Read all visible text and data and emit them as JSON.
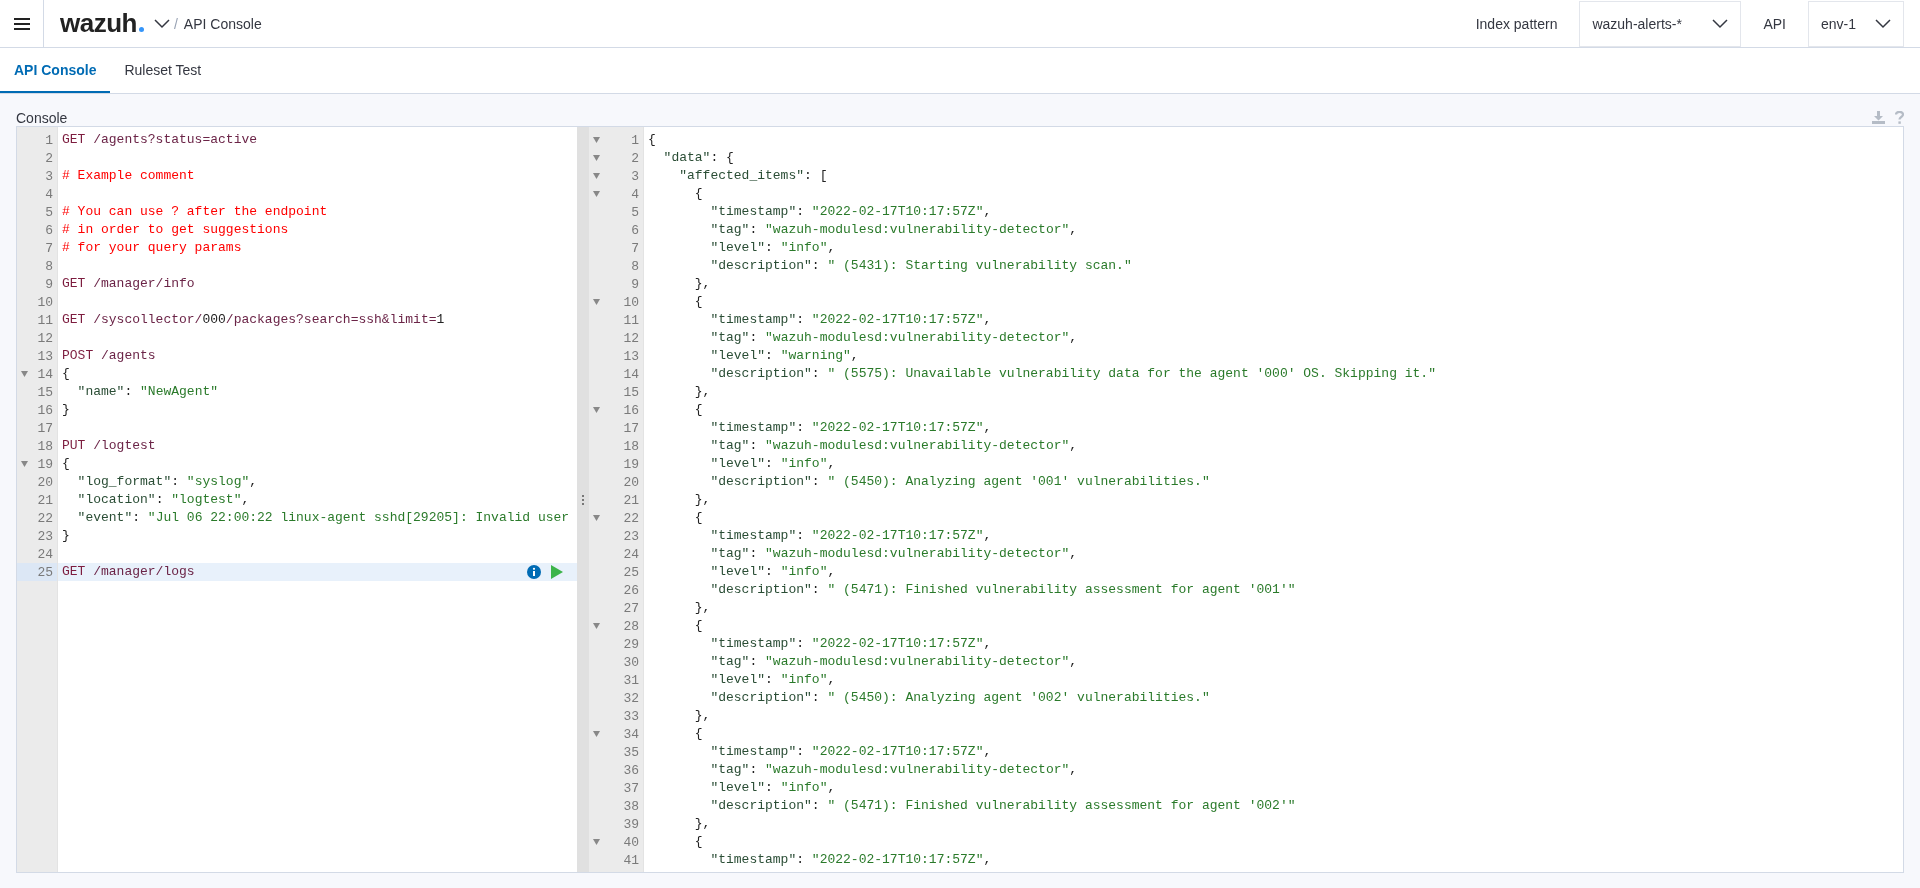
{
  "header": {
    "logo": "wazuh",
    "breadcrumb_separator": "/",
    "breadcrumb": "API Console",
    "index_pattern_label": "Index pattern",
    "index_pattern_value": "wazuh-alerts-*",
    "api_label": "API",
    "api_value": "env-1"
  },
  "tabs": [
    {
      "label": "API Console",
      "selected": true
    },
    {
      "label": "Ruleset Test",
      "selected": false
    }
  ],
  "console": {
    "title": "Console",
    "request_lines": [
      {
        "n": "1",
        "fold": false,
        "active": false,
        "tokens": [
          {
            "kind": "method",
            "text": "GET"
          },
          {
            "kind": "url",
            "text": " /agents?status=active"
          }
        ]
      },
      {
        "n": "2",
        "fold": false,
        "active": false
      },
      {
        "n": "3",
        "fold": false,
        "active": false,
        "tokens": [
          {
            "kind": "comment",
            "text": "# Example comment"
          }
        ]
      },
      {
        "n": "4",
        "fold": false,
        "active": false
      },
      {
        "n": "5",
        "fold": false,
        "active": false,
        "tokens": [
          {
            "kind": "comment",
            "text": "# You can use ? after the endpoint"
          }
        ]
      },
      {
        "n": "6",
        "fold": false,
        "active": false,
        "tokens": [
          {
            "kind": "comment",
            "text": "# in order to get suggestions"
          }
        ]
      },
      {
        "n": "7",
        "fold": false,
        "active": false,
        "tokens": [
          {
            "kind": "comment",
            "text": "# for your query params"
          }
        ]
      },
      {
        "n": "8",
        "fold": false,
        "active": false
      },
      {
        "n": "9",
        "fold": false,
        "active": false,
        "tokens": [
          {
            "kind": "method",
            "text": "GET"
          },
          {
            "kind": "url",
            "text": " /manager/info"
          }
        ]
      },
      {
        "n": "10",
        "fold": false,
        "active": false
      },
      {
        "n": "11",
        "fold": false,
        "active": false,
        "tokens": [
          {
            "kind": "method",
            "text": "GET"
          },
          {
            "kind": "url",
            "text": " /syscollector/"
          },
          {
            "kind": "punct",
            "text": "000"
          },
          {
            "kind": "url",
            "text": "/packages?search=ssh&limit="
          },
          {
            "kind": "punct",
            "text": "1"
          }
        ]
      },
      {
        "n": "12",
        "fold": false,
        "active": false
      },
      {
        "n": "13",
        "fold": false,
        "active": false,
        "tokens": [
          {
            "kind": "method",
            "text": "POST"
          },
          {
            "kind": "url",
            "text": " /agents"
          }
        ]
      },
      {
        "n": "14",
        "fold": true,
        "active": false,
        "tokens": [
          {
            "kind": "punct",
            "text": "{"
          }
        ]
      },
      {
        "n": "15",
        "fold": false,
        "active": false,
        "tokens": [
          {
            "kind": "key",
            "text": "  \"name\""
          },
          {
            "kind": "punct",
            "text": ": "
          },
          {
            "kind": "string",
            "text": "\"NewAgent\""
          }
        ]
      },
      {
        "n": "16",
        "fold": false,
        "active": false,
        "tokens": [
          {
            "kind": "punct",
            "text": "}"
          }
        ]
      },
      {
        "n": "17",
        "fold": false,
        "active": false
      },
      {
        "n": "18",
        "fold": false,
        "active": false,
        "tokens": [
          {
            "kind": "method",
            "text": "PUT"
          },
          {
            "kind": "url",
            "text": " /logtest"
          }
        ]
      },
      {
        "n": "19",
        "fold": true,
        "active": false,
        "tokens": [
          {
            "kind": "punct",
            "text": "{"
          }
        ]
      },
      {
        "n": "20",
        "fold": false,
        "active": false,
        "tokens": [
          {
            "kind": "key",
            "text": "  \"log_format\""
          },
          {
            "kind": "punct",
            "text": ": "
          },
          {
            "kind": "string",
            "text": "\"syslog\""
          },
          {
            "kind": "punct",
            "text": ","
          }
        ]
      },
      {
        "n": "21",
        "fold": false,
        "active": false,
        "tokens": [
          {
            "kind": "key",
            "text": "  \"location\""
          },
          {
            "kind": "punct",
            "text": ": "
          },
          {
            "kind": "string",
            "text": "\"logtest\""
          },
          {
            "kind": "punct",
            "text": ","
          }
        ]
      },
      {
        "n": "22",
        "fold": false,
        "active": false,
        "tokens": [
          {
            "kind": "key",
            "text": "  \"event\""
          },
          {
            "kind": "punct",
            "text": ": "
          },
          {
            "kind": "string",
            "text": "\"Jul 06 22:00:22 linux-agent sshd[29205]: Invalid user"
          }
        ]
      },
      {
        "n": "23",
        "fold": false,
        "active": false,
        "tokens": [
          {
            "kind": "punct",
            "text": "}"
          }
        ]
      },
      {
        "n": "24",
        "fold": false,
        "active": false
      },
      {
        "n": "25",
        "fold": false,
        "active": true,
        "tokens": [
          {
            "kind": "method",
            "text": "GET"
          },
          {
            "kind": "url",
            "text": " /manager/logs"
          }
        ]
      }
    ],
    "response_lines": [
      {
        "n": "1",
        "fold": true,
        "tokens": [
          {
            "kind": "punct",
            "text": "{"
          }
        ]
      },
      {
        "n": "2",
        "fold": true,
        "tokens": [
          {
            "kind": "key",
            "text": "  \"data\""
          },
          {
            "kind": "punct",
            "text": ": {"
          }
        ]
      },
      {
        "n": "3",
        "fold": true,
        "tokens": [
          {
            "kind": "key",
            "text": "    \"affected_items\""
          },
          {
            "kind": "punct",
            "text": ": ["
          }
        ]
      },
      {
        "n": "4",
        "fold": true,
        "tokens": [
          {
            "kind": "punct",
            "text": "      {"
          }
        ]
      },
      {
        "n": "5",
        "fold": false,
        "tokens": [
          {
            "kind": "key",
            "text": "        \"timestamp\""
          },
          {
            "kind": "punct",
            "text": ": "
          },
          {
            "kind": "string",
            "text": "\"2022-02-17T10:17:57Z\""
          },
          {
            "kind": "punct",
            "text": ","
          }
        ]
      },
      {
        "n": "6",
        "fold": false,
        "tokens": [
          {
            "kind": "key",
            "text": "        \"tag\""
          },
          {
            "kind": "punct",
            "text": ": "
          },
          {
            "kind": "string",
            "text": "\"wazuh-modulesd:vulnerability-detector\""
          },
          {
            "kind": "punct",
            "text": ","
          }
        ]
      },
      {
        "n": "7",
        "fold": false,
        "tokens": [
          {
            "kind": "key",
            "text": "        \"level\""
          },
          {
            "kind": "punct",
            "text": ": "
          },
          {
            "kind": "string",
            "text": "\"info\""
          },
          {
            "kind": "punct",
            "text": ","
          }
        ]
      },
      {
        "n": "8",
        "fold": false,
        "tokens": [
          {
            "kind": "key",
            "text": "        \"description\""
          },
          {
            "kind": "punct",
            "text": ": "
          },
          {
            "kind": "string",
            "text": "\" (5431): Starting vulnerability scan.\""
          }
        ]
      },
      {
        "n": "9",
        "fold": false,
        "tokens": [
          {
            "kind": "punct",
            "text": "      },"
          }
        ]
      },
      {
        "n": "10",
        "fold": true,
        "tokens": [
          {
            "kind": "punct",
            "text": "      {"
          }
        ]
      },
      {
        "n": "11",
        "fold": false,
        "tokens": [
          {
            "kind": "key",
            "text": "        \"timestamp\""
          },
          {
            "kind": "punct",
            "text": ": "
          },
          {
            "kind": "string",
            "text": "\"2022-02-17T10:17:57Z\""
          },
          {
            "kind": "punct",
            "text": ","
          }
        ]
      },
      {
        "n": "12",
        "fold": false,
        "tokens": [
          {
            "kind": "key",
            "text": "        \"tag\""
          },
          {
            "kind": "punct",
            "text": ": "
          },
          {
            "kind": "string",
            "text": "\"wazuh-modulesd:vulnerability-detector\""
          },
          {
            "kind": "punct",
            "text": ","
          }
        ]
      },
      {
        "n": "13",
        "fold": false,
        "tokens": [
          {
            "kind": "key",
            "text": "        \"level\""
          },
          {
            "kind": "punct",
            "text": ": "
          },
          {
            "kind": "string",
            "text": "\"warning\""
          },
          {
            "kind": "punct",
            "text": ","
          }
        ]
      },
      {
        "n": "14",
        "fold": false,
        "tokens": [
          {
            "kind": "key",
            "text": "        \"description\""
          },
          {
            "kind": "punct",
            "text": ": "
          },
          {
            "kind": "string",
            "text": "\" (5575): Unavailable vulnerability data for the agent '000' OS. Skipping it.\""
          }
        ]
      },
      {
        "n": "15",
        "fold": false,
        "tokens": [
          {
            "kind": "punct",
            "text": "      },"
          }
        ]
      },
      {
        "n": "16",
        "fold": true,
        "tokens": [
          {
            "kind": "punct",
            "text": "      {"
          }
        ]
      },
      {
        "n": "17",
        "fold": false,
        "tokens": [
          {
            "kind": "key",
            "text": "        \"timestamp\""
          },
          {
            "kind": "punct",
            "text": ": "
          },
          {
            "kind": "string",
            "text": "\"2022-02-17T10:17:57Z\""
          },
          {
            "kind": "punct",
            "text": ","
          }
        ]
      },
      {
        "n": "18",
        "fold": false,
        "tokens": [
          {
            "kind": "key",
            "text": "        \"tag\""
          },
          {
            "kind": "punct",
            "text": ": "
          },
          {
            "kind": "string",
            "text": "\"wazuh-modulesd:vulnerability-detector\""
          },
          {
            "kind": "punct",
            "text": ","
          }
        ]
      },
      {
        "n": "19",
        "fold": false,
        "tokens": [
          {
            "kind": "key",
            "text": "        \"level\""
          },
          {
            "kind": "punct",
            "text": ": "
          },
          {
            "kind": "string",
            "text": "\"info\""
          },
          {
            "kind": "punct",
            "text": ","
          }
        ]
      },
      {
        "n": "20",
        "fold": false,
        "tokens": [
          {
            "kind": "key",
            "text": "        \"description\""
          },
          {
            "kind": "punct",
            "text": ": "
          },
          {
            "kind": "string",
            "text": "\" (5450): Analyzing agent '001' vulnerabilities.\""
          }
        ]
      },
      {
        "n": "21",
        "fold": false,
        "tokens": [
          {
            "kind": "punct",
            "text": "      },"
          }
        ]
      },
      {
        "n": "22",
        "fold": true,
        "tokens": [
          {
            "kind": "punct",
            "text": "      {"
          }
        ]
      },
      {
        "n": "23",
        "fold": false,
        "tokens": [
          {
            "kind": "key",
            "text": "        \"timestamp\""
          },
          {
            "kind": "punct",
            "text": ": "
          },
          {
            "kind": "string",
            "text": "\"2022-02-17T10:17:57Z\""
          },
          {
            "kind": "punct",
            "text": ","
          }
        ]
      },
      {
        "n": "24",
        "fold": false,
        "tokens": [
          {
            "kind": "key",
            "text": "        \"tag\""
          },
          {
            "kind": "punct",
            "text": ": "
          },
          {
            "kind": "string",
            "text": "\"wazuh-modulesd:vulnerability-detector\""
          },
          {
            "kind": "punct",
            "text": ","
          }
        ]
      },
      {
        "n": "25",
        "fold": false,
        "tokens": [
          {
            "kind": "key",
            "text": "        \"level\""
          },
          {
            "kind": "punct",
            "text": ": "
          },
          {
            "kind": "string",
            "text": "\"info\""
          },
          {
            "kind": "punct",
            "text": ","
          }
        ]
      },
      {
        "n": "26",
        "fold": false,
        "tokens": [
          {
            "kind": "key",
            "text": "        \"description\""
          },
          {
            "kind": "punct",
            "text": ": "
          },
          {
            "kind": "string",
            "text": "\" (5471): Finished vulnerability assessment for agent '001'\""
          }
        ]
      },
      {
        "n": "27",
        "fold": false,
        "tokens": [
          {
            "kind": "punct",
            "text": "      },"
          }
        ]
      },
      {
        "n": "28",
        "fold": true,
        "tokens": [
          {
            "kind": "punct",
            "text": "      {"
          }
        ]
      },
      {
        "n": "29",
        "fold": false,
        "tokens": [
          {
            "kind": "key",
            "text": "        \"timestamp\""
          },
          {
            "kind": "punct",
            "text": ": "
          },
          {
            "kind": "string",
            "text": "\"2022-02-17T10:17:57Z\""
          },
          {
            "kind": "punct",
            "text": ","
          }
        ]
      },
      {
        "n": "30",
        "fold": false,
        "tokens": [
          {
            "kind": "key",
            "text": "        \"tag\""
          },
          {
            "kind": "punct",
            "text": ": "
          },
          {
            "kind": "string",
            "text": "\"wazuh-modulesd:vulnerability-detector\""
          },
          {
            "kind": "punct",
            "text": ","
          }
        ]
      },
      {
        "n": "31",
        "fold": false,
        "tokens": [
          {
            "kind": "key",
            "text": "        \"level\""
          },
          {
            "kind": "punct",
            "text": ": "
          },
          {
            "kind": "string",
            "text": "\"info\""
          },
          {
            "kind": "punct",
            "text": ","
          }
        ]
      },
      {
        "n": "32",
        "fold": false,
        "tokens": [
          {
            "kind": "key",
            "text": "        \"description\""
          },
          {
            "kind": "punct",
            "text": ": "
          },
          {
            "kind": "string",
            "text": "\" (5450): Analyzing agent '002' vulnerabilities.\""
          }
        ]
      },
      {
        "n": "33",
        "fold": false,
        "tokens": [
          {
            "kind": "punct",
            "text": "      },"
          }
        ]
      },
      {
        "n": "34",
        "fold": true,
        "tokens": [
          {
            "kind": "punct",
            "text": "      {"
          }
        ]
      },
      {
        "n": "35",
        "fold": false,
        "tokens": [
          {
            "kind": "key",
            "text": "        \"timestamp\""
          },
          {
            "kind": "punct",
            "text": ": "
          },
          {
            "kind": "string",
            "text": "\"2022-02-17T10:17:57Z\""
          },
          {
            "kind": "punct",
            "text": ","
          }
        ]
      },
      {
        "n": "36",
        "fold": false,
        "tokens": [
          {
            "kind": "key",
            "text": "        \"tag\""
          },
          {
            "kind": "punct",
            "text": ": "
          },
          {
            "kind": "string",
            "text": "\"wazuh-modulesd:vulnerability-detector\""
          },
          {
            "kind": "punct",
            "text": ","
          }
        ]
      },
      {
        "n": "37",
        "fold": false,
        "tokens": [
          {
            "kind": "key",
            "text": "        \"level\""
          },
          {
            "kind": "punct",
            "text": ": "
          },
          {
            "kind": "string",
            "text": "\"info\""
          },
          {
            "kind": "punct",
            "text": ","
          }
        ]
      },
      {
        "n": "38",
        "fold": false,
        "tokens": [
          {
            "kind": "key",
            "text": "        \"description\""
          },
          {
            "kind": "punct",
            "text": ": "
          },
          {
            "kind": "string",
            "text": "\" (5471): Finished vulnerability assessment for agent '002'\""
          }
        ]
      },
      {
        "n": "39",
        "fold": false,
        "tokens": [
          {
            "kind": "punct",
            "text": "      },"
          }
        ]
      },
      {
        "n": "40",
        "fold": true,
        "tokens": [
          {
            "kind": "punct",
            "text": "      {"
          }
        ]
      },
      {
        "n": "41",
        "fold": false,
        "tokens": [
          {
            "kind": "key",
            "text": "        \"timestamp\""
          },
          {
            "kind": "punct",
            "text": ": "
          },
          {
            "kind": "string",
            "text": "\"2022-02-17T10:17:57Z\""
          },
          {
            "kind": "punct",
            "text": ","
          }
        ]
      }
    ]
  }
}
